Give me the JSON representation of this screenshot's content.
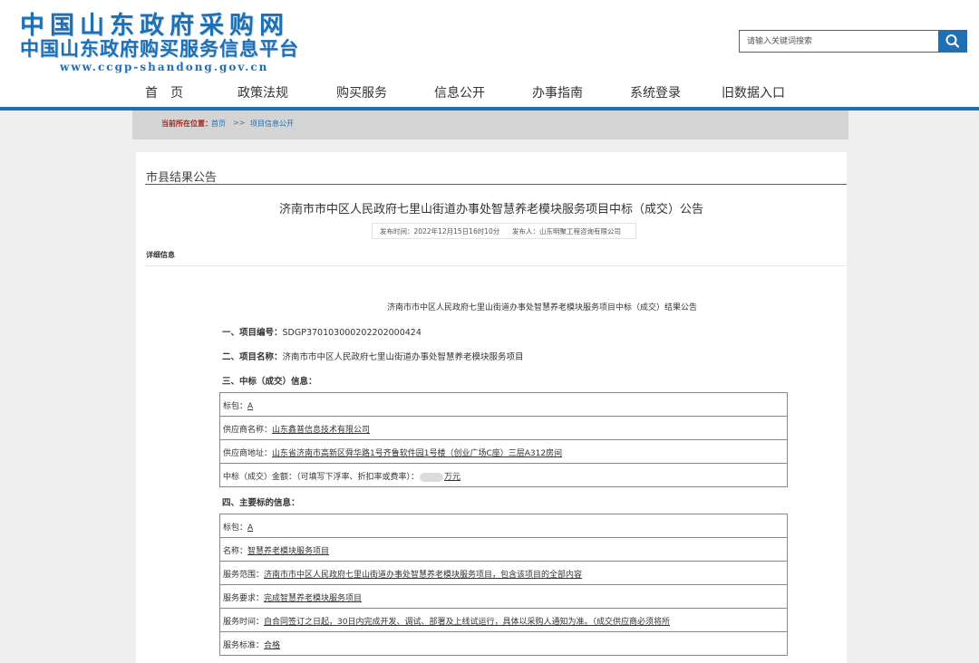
{
  "site": {
    "logo_line1": "中国山东政府采购网",
    "logo_line2": "中国山东政府购买服务信息平台",
    "logo_line3": "www.ccgp-shandong.gov.cn",
    "brand_color": "#1e6fb4"
  },
  "search": {
    "placeholder": "请输入关键词搜索",
    "icon": "search-icon"
  },
  "nav": [
    {
      "label": "首　页"
    },
    {
      "label": "政策法规"
    },
    {
      "label": "购买服务"
    },
    {
      "label": "信息公开"
    },
    {
      "label": "办事指南"
    },
    {
      "label": "系统登录"
    },
    {
      "label": "旧数据入口"
    }
  ],
  "breadcrumb": {
    "prefix": "当前所在位置：",
    "home": "首页",
    "sep": ">>",
    "current": "项目信息公开"
  },
  "section": {
    "title": "市县结果公告"
  },
  "notice": {
    "title": "济南市市中区人民政府七里山街道办事处智慧养老模块服务项目中标（成交）公告",
    "publish_time": "发布时间：2022年12月15日16时10分",
    "publisher": "发布人：山东明聚工程咨询有限公司",
    "detail_label": "详细信息",
    "doc_title": "济南市市中区人民政府七里山街道办事处智慧养老模块服务项目中标（成交）结果公告",
    "item1_label": "一、项目编号：",
    "item1_value": "SDGP370103000202202000424",
    "item2_label": "二、项目名称：",
    "item2_value": "济南市市中区人民政府七里山街道办事处智慧养老模块服务项目",
    "item3_label": "三、中标（成交）信息：",
    "win_table": [
      {
        "label": "标包：",
        "value": "A"
      },
      {
        "label": "供应商名称：",
        "value": "山东鑫普信息技术有限公司"
      },
      {
        "label": "供应商地址：",
        "value": "山东省济南市高新区舜华路1号齐鲁软件园1号楼（创业广场C座）三层A312房间"
      },
      {
        "label": "中标（成交）金额：（可填写下浮率、折扣率或费率）：",
        "value": "万元"
      }
    ],
    "item4_label": "四、主要标的信息：",
    "subject_table": [
      {
        "label": "标包：",
        "value": "A"
      },
      {
        "label": "名称：",
        "value": "智慧养老模块服务项目"
      },
      {
        "label": "服务范围：",
        "value": "济南市市中区人民政府七里山街道办事处智慧养老模块服务项目，包含该项目的全部内容"
      },
      {
        "label": "服务要求：",
        "value": "完成智慧养老模块服务项目"
      },
      {
        "label": "服务时间：",
        "value": "自合同签订之日起，30日内完成开发、调试、部署及上线试运行，具体以采购人通知为准。（成交供应商必须将所"
      },
      {
        "label": "服务标准：",
        "value": "合格"
      }
    ]
  }
}
